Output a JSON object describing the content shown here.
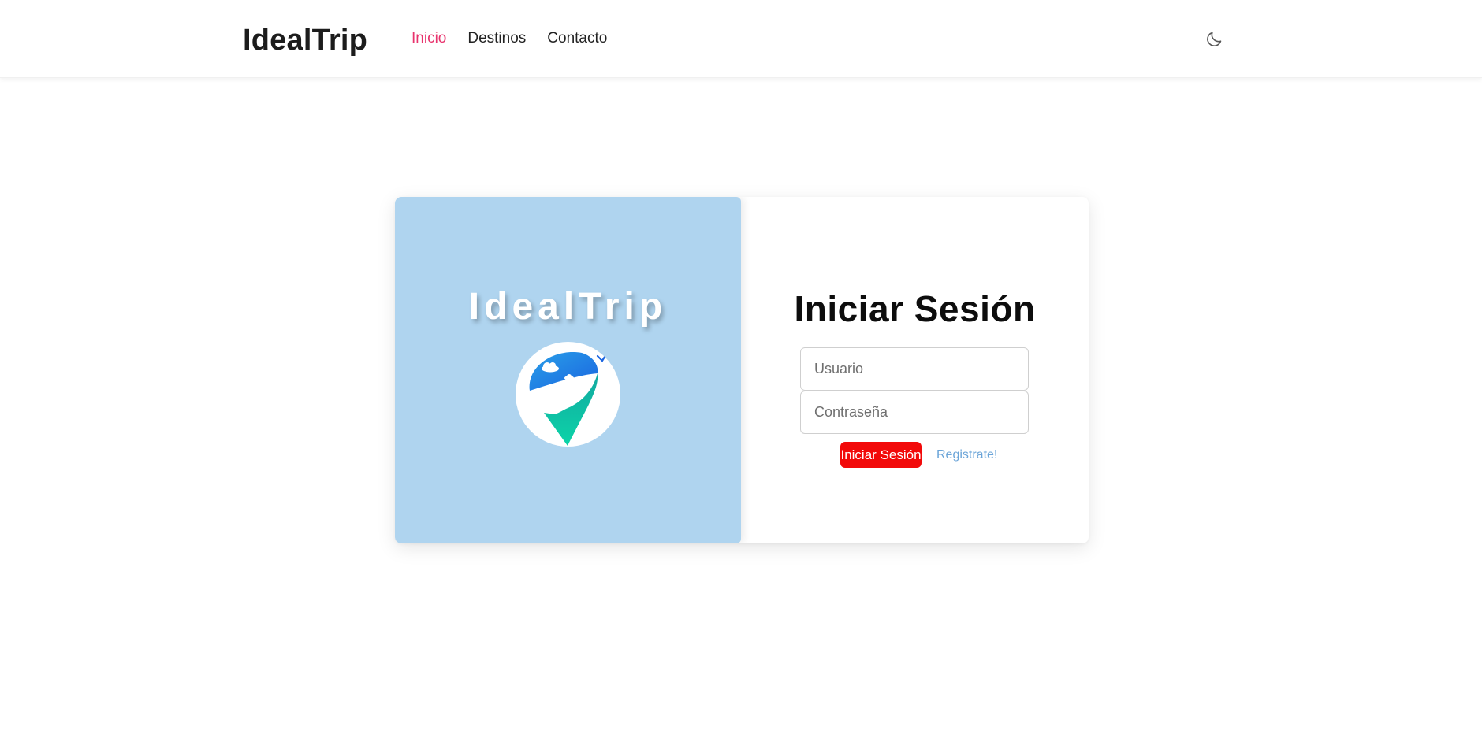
{
  "colors": {
    "accent": "#e8336d",
    "button_red": "#f20a0a",
    "left_panel": "#afd4ef",
    "link_blue": "#6aa4d8"
  },
  "header": {
    "brand": "IdealTrip",
    "nav": [
      {
        "label": "Inicio",
        "active": true
      },
      {
        "label": "Destinos",
        "active": false
      },
      {
        "label": "Contacto",
        "active": false
      }
    ],
    "theme_toggle_icon": "moon-icon"
  },
  "card": {
    "left": {
      "title": "IdealTrip",
      "logo_icon": "location-pin-logo-icon"
    },
    "right": {
      "title": "Iniciar Sesión",
      "username_placeholder": "Usuario",
      "username_value": "",
      "password_placeholder": "Contraseña",
      "password_value": "",
      "submit_label": "Iniciar Sesión",
      "register_label": "Registrate!"
    }
  }
}
